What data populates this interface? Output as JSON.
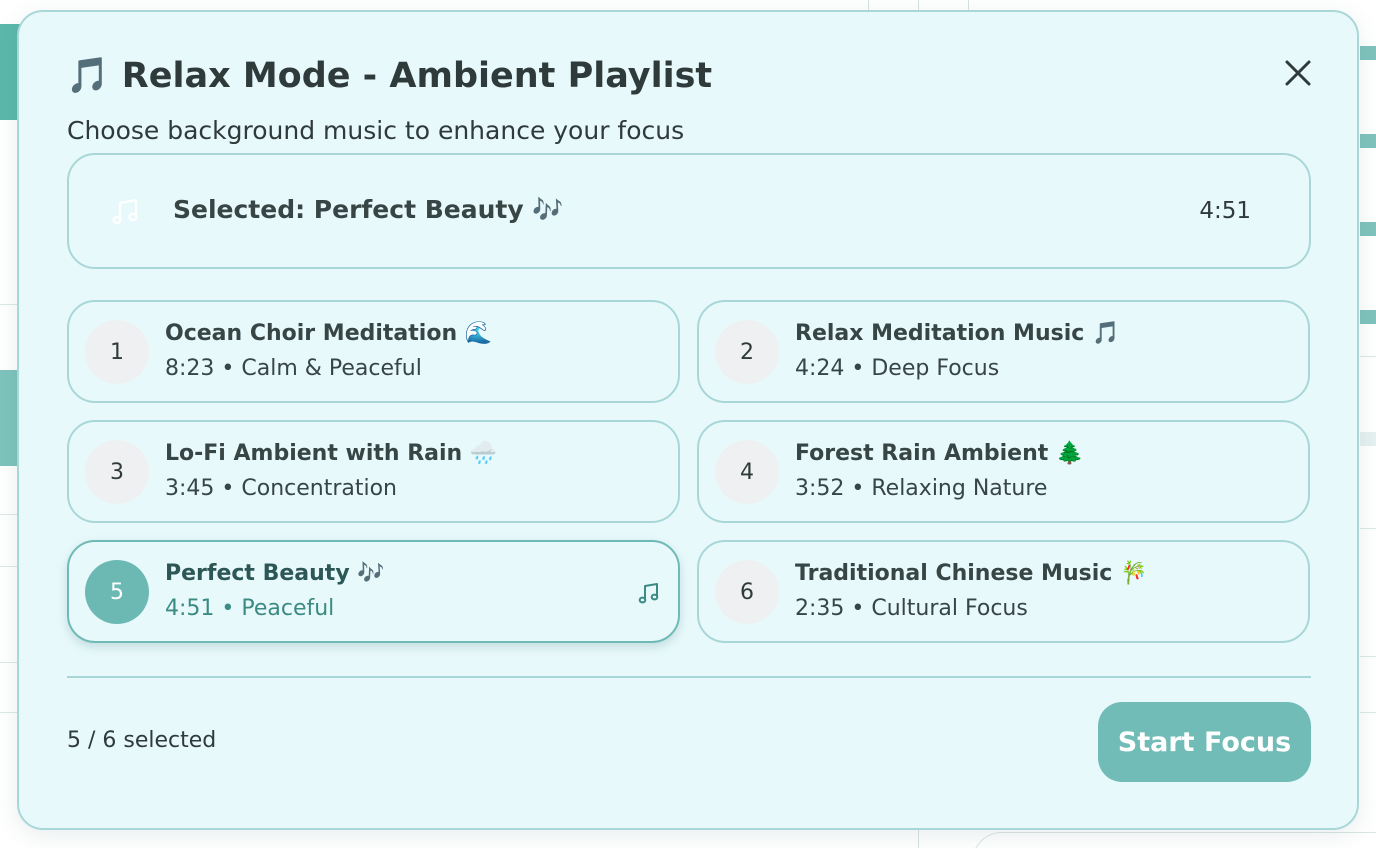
{
  "modal": {
    "title": "🎵 Relax Mode - Ambient Playlist",
    "subtitle": "Choose background music to enhance your focus",
    "close_icon": "close-icon"
  },
  "selected": {
    "label": "Selected: Perfect Beauty 🎶",
    "duration": "4:51",
    "icon": "music-notes-icon"
  },
  "tracks": [
    {
      "number": "1",
      "title": "Ocean Choir Meditation 🌊",
      "meta": "8:23 • Calm & Peaceful",
      "active": false
    },
    {
      "number": "2",
      "title": "Relax Meditation Music 🎵",
      "meta": "4:24 • Deep Focus",
      "active": false
    },
    {
      "number": "3",
      "title": "Lo-Fi Ambient with Rain 🌧️",
      "meta": "3:45 • Concentration",
      "active": false
    },
    {
      "number": "4",
      "title": "Forest Rain Ambient 🌲",
      "meta": "3:52 • Relaxing Nature",
      "active": false
    },
    {
      "number": "5",
      "title": "Perfect Beauty 🎶",
      "meta": "4:51 • Peaceful",
      "active": true
    },
    {
      "number": "6",
      "title": "Traditional Chinese Music 🎋",
      "meta": "2:35 • Cultural Focus",
      "active": false
    }
  ],
  "footer": {
    "count": "5 / 6 selected",
    "start_label": "Start Focus"
  },
  "colors": {
    "modal_bg": "#e8f9fb",
    "border": "#a9d7d8",
    "accent": "#72bcb7",
    "active_text": "#3b8a83"
  }
}
